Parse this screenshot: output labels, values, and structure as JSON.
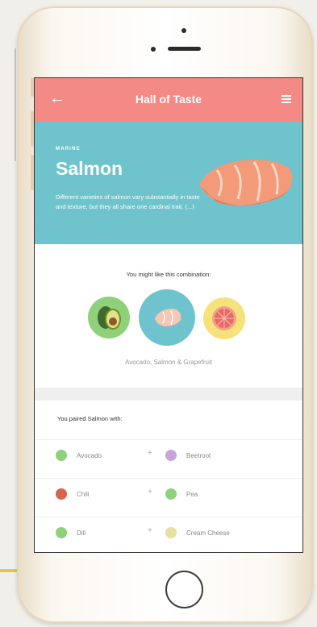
{
  "nav": {
    "back_icon": "arrow-left-icon",
    "title": "Hall of Taste",
    "menu_icon": "hamburger-menu-icon"
  },
  "hero": {
    "kicker": "MARINE",
    "title": "Salmon",
    "description": "Different varieties of salmon vary substantially in taste and texture, but they all share one cardinal trait. (...)",
    "image": "salmon-fillet-image"
  },
  "combination": {
    "label": "You might like this combination:",
    "items": [
      "avocado",
      "salmon",
      "grapefruit"
    ],
    "names": "Avocado, Salmon & Grapefruit"
  },
  "paired": {
    "heading": "You paired Salmon with:",
    "rows": [
      {
        "left": {
          "name": "Avocado",
          "color": "#8fd17a"
        },
        "plus": "+",
        "right": {
          "name": "Beetroot",
          "color": "#c7a5d8"
        }
      },
      {
        "left": {
          "name": "Chili",
          "color": "#d9634b"
        },
        "plus": "+",
        "right": {
          "name": "Pea",
          "color": "#8fd17a"
        }
      },
      {
        "left": {
          "name": "Dill",
          "color": "#8fd17a"
        },
        "plus": "+",
        "right": {
          "name": "Cream Cheese",
          "color": "#e6e0a2"
        }
      }
    ]
  },
  "colors": {
    "nav": "#f48a85",
    "hero": "#6fc3cc",
    "combo_avocado": "#8fd17a",
    "combo_salmon": "#6fc3cc",
    "combo_grapefruit": "#f6e27a"
  }
}
